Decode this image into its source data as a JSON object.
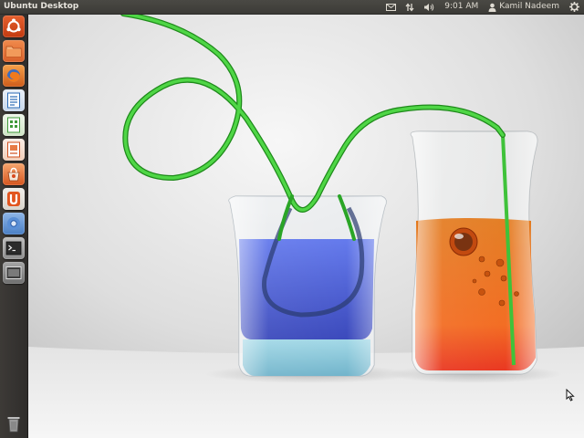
{
  "panel": {
    "title": "Ubuntu Desktop",
    "time": "9:01 AM",
    "user": "Kamil Nadeem"
  },
  "indicators": [
    {
      "icon": "mail-icon"
    },
    {
      "icon": "network-icon"
    },
    {
      "icon": "volume-icon"
    },
    {
      "icon": "user-icon"
    },
    {
      "icon": "session-gear-icon"
    }
  ],
  "launcher": [
    {
      "icon": "dash-home-icon",
      "color": "#d84a1e"
    },
    {
      "icon": "home-folder-icon",
      "color": "#e2733a"
    },
    {
      "icon": "firefox-icon",
      "color": "#e8762b"
    },
    {
      "icon": "libreoffice-writer-icon",
      "color": "#2a6ab5"
    },
    {
      "icon": "libreoffice-calc-icon",
      "color": "#3f9a3a"
    },
    {
      "icon": "libreoffice-impress-icon",
      "color": "#d0501f"
    },
    {
      "icon": "software-center-icon",
      "color": "#dd6b2d"
    },
    {
      "icon": "ubuntu-one-icon",
      "color": "#d84a1e"
    },
    {
      "icon": "chromium-icon",
      "color": "#4a7fc4"
    },
    {
      "icon": "terminal-icon",
      "color": "#4a4a4a"
    },
    {
      "icon": "workspace-switcher-icon",
      "color": "#5a5a5a"
    },
    {
      "icon": "trash-icon",
      "color": "#5a5a5a"
    }
  ],
  "colors": {
    "panel_bg": "#3c3b37",
    "launcher_bg": "#2f2d2b",
    "wallpaper_tube": "#3fc23a",
    "liquid_blue": "#4a5fd6",
    "liquid_orange": "#f2741c"
  }
}
